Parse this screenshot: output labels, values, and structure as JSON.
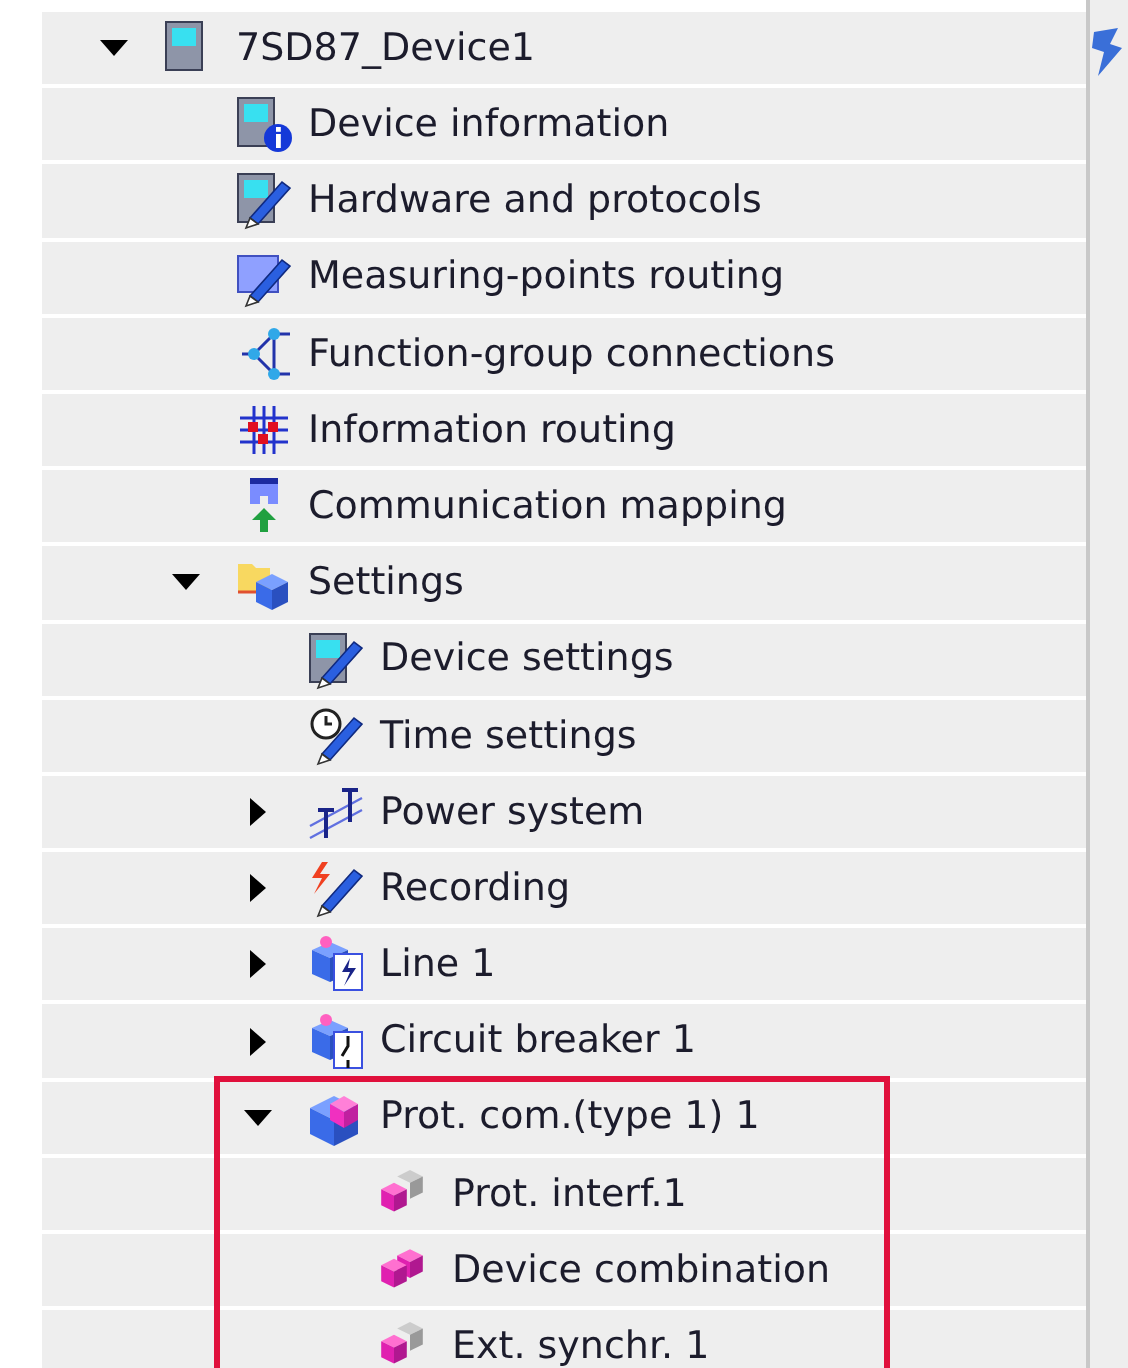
{
  "tree": [
    {
      "label": "7SD87_Device1",
      "expanded": true,
      "children": [
        {
          "label": "Device information"
        },
        {
          "label": "Hardware and protocols"
        },
        {
          "label": "Measuring-points routing"
        },
        {
          "label": "Function-group connections"
        },
        {
          "label": "Information routing"
        },
        {
          "label": "Communication mapping"
        },
        {
          "label": "Settings",
          "expanded": true,
          "children": [
            {
              "label": "Device settings"
            },
            {
              "label": "Time settings"
            },
            {
              "label": "Power system",
              "expanded": false
            },
            {
              "label": "Recording",
              "expanded": false
            },
            {
              "label": "Line 1",
              "expanded": false
            },
            {
              "label": "Circuit breaker 1",
              "expanded": false
            },
            {
              "label": "Prot. com.(type 1) 1",
              "expanded": true,
              "highlighted": true,
              "children": [
                {
                  "label": "Prot. interf.1"
                },
                {
                  "label": "Device combination"
                },
                {
                  "label": "Ext. synchr. 1"
                }
              ]
            }
          ]
        }
      ]
    }
  ]
}
